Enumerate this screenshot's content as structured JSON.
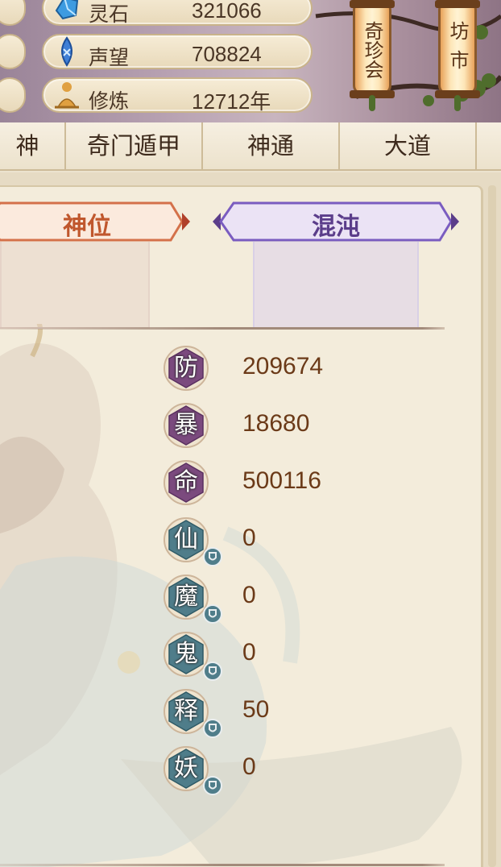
{
  "header": {
    "resources": [
      {
        "icon": "spirit-stone-icon",
        "label": "灵石",
        "value": "321066"
      },
      {
        "icon": "reputation-gem-icon",
        "label": "声望",
        "value": "708824"
      },
      {
        "icon": "meditation-icon",
        "label": "修炼",
        "value": "12712年"
      }
    ],
    "lanterns": [
      {
        "label": "奇珍会"
      },
      {
        "label": "坊市"
      }
    ]
  },
  "tabs": [
    {
      "label": "神"
    },
    {
      "label": "奇门遁甲"
    },
    {
      "label": "神通"
    },
    {
      "label": "大道"
    }
  ],
  "categories": [
    {
      "label": "神位",
      "color": "#c0572d"
    },
    {
      "label": "混沌",
      "color": "#5b3d8a"
    }
  ],
  "stats": [
    {
      "char": "防",
      "value": "209674",
      "style": "purple"
    },
    {
      "char": "暴",
      "value": "18680",
      "style": "purple"
    },
    {
      "char": "命",
      "value": "500116",
      "style": "purple"
    },
    {
      "char": "仙",
      "value": "0",
      "style": "teal"
    },
    {
      "char": "魔",
      "value": "0",
      "style": "teal"
    },
    {
      "char": "鬼",
      "value": "0",
      "style": "teal"
    },
    {
      "char": "释",
      "value": "50",
      "style": "teal"
    },
    {
      "char": "妖",
      "value": "0",
      "style": "teal"
    }
  ],
  "colors": {
    "purple_badge": "#7b4a7e",
    "teal_badge": "#4f7d8a",
    "value_text": "#6b3a18"
  }
}
